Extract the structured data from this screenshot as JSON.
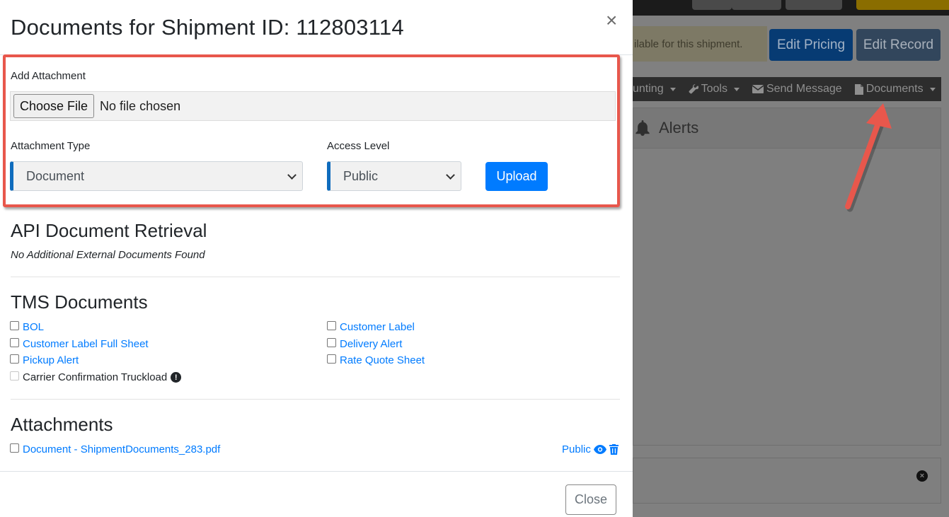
{
  "background": {
    "alert_text": "ilable for this shipment.",
    "edit_pricing_label": "Edit Pricing",
    "edit_record_label": "Edit Record",
    "nav": {
      "accounting": "unting",
      "tools": "Tools",
      "send_message": "Send Message",
      "documents": "Documents"
    },
    "alerts_title": "Alerts"
  },
  "modal": {
    "title": "Documents for Shipment ID: 112803114",
    "close_x": "×",
    "upload_form": {
      "add_attachment_label": "Add Attachment",
      "choose_file_label": "Choose File",
      "no_file_text": "No file chosen",
      "attachment_type_label": "Attachment Type",
      "attachment_type_value": "Document",
      "access_level_label": "Access Level",
      "access_level_value": "Public",
      "upload_label": "Upload"
    },
    "api_section": {
      "heading": "API Document Retrieval",
      "empty_text": "No Additional External Documents Found"
    },
    "tms_section": {
      "heading": "TMS Documents",
      "left_items": [
        "BOL",
        "Customer Label Full Sheet",
        "Pickup Alert"
      ],
      "right_items": [
        "Customer Label",
        "Delivery Alert",
        "Rate Quote Sheet"
      ],
      "disabled_item": "Carrier Confirmation Truckload"
    },
    "attachments_section": {
      "heading": "Attachments",
      "items": [
        {
          "name": "Document - ShipmentDocuments_283.pdf",
          "access": "Public"
        }
      ]
    },
    "footer": {
      "close_label": "Close"
    }
  },
  "colors": {
    "link": "#007bff",
    "highlight": "#e8574c",
    "primary": "#007bff"
  }
}
